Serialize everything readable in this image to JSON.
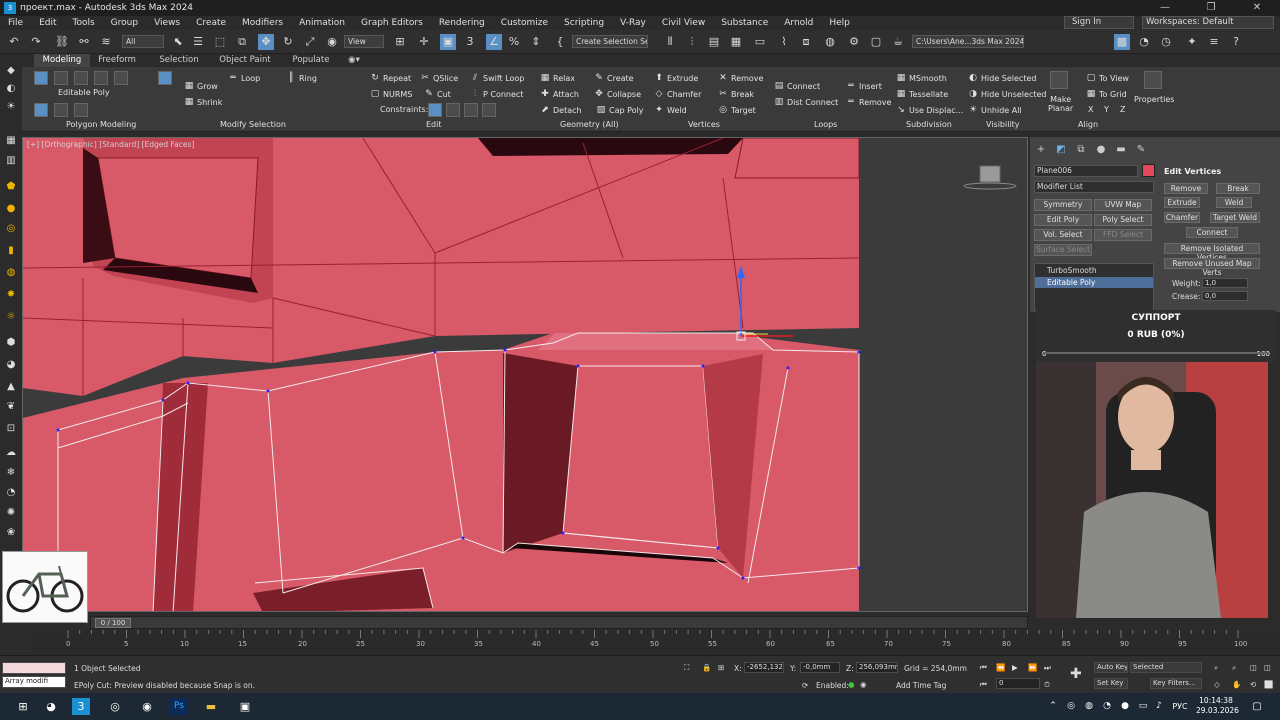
{
  "window": {
    "title": "проект.max - Autodesk 3ds Max 2024",
    "controls": [
      "—",
      "❐",
      "✕"
    ]
  },
  "menu": [
    "File",
    "Edit",
    "Tools",
    "Group",
    "Views",
    "Create",
    "Modifiers",
    "Animation",
    "Graph Editors",
    "Rendering",
    "Customize",
    "Scripting",
    "V-Ray",
    "Civil View",
    "Substance",
    "Arnold",
    "Help"
  ],
  "account": {
    "sign_in": "Sign In",
    "workspaces": "Workspaces: Default"
  },
  "toolbar": {
    "selection_filter": "All",
    "ref_coord": "View",
    "named_selection": "Create Selection Se",
    "project_path": "C:\\Users\\Ane...3ds Max 2024"
  },
  "ribbon_tabs": [
    "Modeling",
    "Freeform",
    "Selection",
    "Object Paint",
    "Populate"
  ],
  "ribbon": {
    "poly_modeling": {
      "object": "Editable Poly",
      "section": "Polygon Modeling"
    },
    "modify_selection": {
      "grow": "Grow",
      "shrink": "Shrink",
      "loop": "Loop",
      "ring": "Ring",
      "section": "Modify Selection"
    },
    "edit": {
      "repeat": "Repeat",
      "qslice": "QSlice",
      "swift_loop": "Swift Loop",
      "nurms": "NURMS",
      "cut": "Cut",
      "p_connect": "P Connect",
      "constraints": "Constraints:",
      "section": "Edit"
    },
    "geometry": {
      "relax": "Relax",
      "create": "Create",
      "attach": "Attach",
      "collapse": "Collapse",
      "detach": "Detach",
      "cap_poly": "Cap Poly",
      "section": "Geometry (All)"
    },
    "vertices": {
      "extrude": "Extrude",
      "remove": "Remove",
      "chamfer": "Chamfer",
      "break": "Break",
      "weld": "Weld",
      "target": "Target",
      "section": "Vertices"
    },
    "loops": {
      "connect": "Connect",
      "insert": "Insert",
      "dist_connect": "Dist Connect",
      "remove": "Remove",
      "section": "Loops"
    },
    "subdivision": {
      "msmooth": "MSmooth",
      "tessellate": "Tessellate",
      "use_displac": "Use Displac...",
      "section": "Subdivision"
    },
    "visibility": {
      "hide_selected": "Hide Selected",
      "hide_unselected": "Hide Unselected",
      "unhide_all": "Unhide All",
      "section": "Visibility"
    },
    "align": {
      "make_planar": "Make Planar",
      "to_view": "To View",
      "to_grid": "To Grid",
      "x": "X",
      "y": "Y",
      "z": "Z",
      "section": "Align"
    },
    "properties": "Properties"
  },
  "viewport": {
    "label": "[+] [Orthographic] [Standard] [Edged Faces]",
    "mesh_color": "#d85a68",
    "wire_color": "#a01a2a",
    "bg_color": "#3b3b3b"
  },
  "command_panel": {
    "object_name": "Plane006",
    "object_color": "#e04a5a",
    "modifier_list": "Modifier List",
    "buttons": [
      "Symmetry",
      "UVW Map",
      "Edit Poly",
      "Poly Select",
      "Vol. Select",
      "FFD Select",
      "Surface Select",
      "FFD Select"
    ],
    "stack": [
      "TurboSmooth",
      "Editable Poly"
    ],
    "edit_vertices": {
      "title": "Edit Vertices",
      "remove": "Remove",
      "break": "Break",
      "extrude": "Extrude",
      "weld": "Weld",
      "chamfer": "Chamfer",
      "target_weld": "Target Weld",
      "connect": "Connect",
      "remove_isolated": "Remove Isolated Vertices",
      "remove_unused": "Remove Unused Map Verts",
      "weight_label": "Weight:",
      "weight": "1,0",
      "crease_label": "Crease:",
      "crease": "0,0"
    }
  },
  "donation": {
    "title": "СУППОРТ",
    "amount": "0 RUB (0%)",
    "min": "0",
    "max": "100",
    "progress": 0
  },
  "timeline": {
    "frame": "0 / 100",
    "ticks": [
      "0",
      "5",
      "10",
      "15",
      "20",
      "25",
      "30",
      "35",
      "40",
      "45",
      "50",
      "55",
      "60",
      "65",
      "70",
      "75",
      "80",
      "85",
      "90",
      "95",
      "100"
    ]
  },
  "status": {
    "maxscript": "Array modifi",
    "objects": "1 Object Selected",
    "prompt": "EPoly Cut: Preview disabled because Snap is on.",
    "x_label": "X:",
    "x": "-2652,132n",
    "y_label": "Y:",
    "y": "-0,0mm",
    "z_label": "Z:",
    "z": "256,093mm",
    "grid": "Grid = 254,0mm",
    "enabled": "Enabled:",
    "add_time_tag": "Add Time Tag",
    "auto_key": "Auto Key",
    "set_key": "Set Key",
    "selected": "Selected",
    "key_filters": "Key Filters...",
    "current_frame": "0"
  },
  "taskbar": {
    "time": "10:14:38",
    "date": "29.03.2026",
    "lang": "РУС"
  }
}
